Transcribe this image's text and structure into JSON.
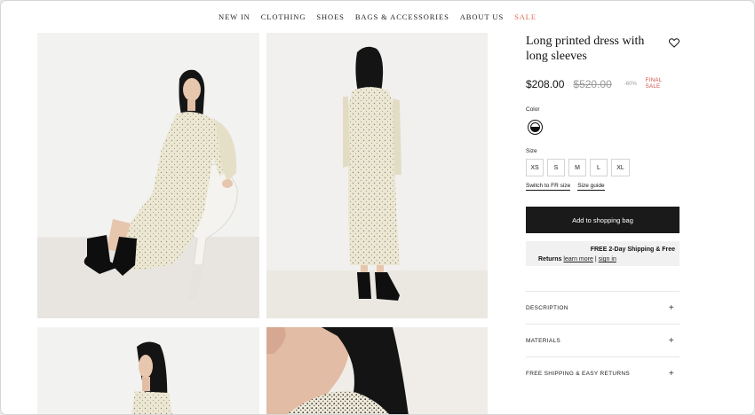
{
  "nav": {
    "items": [
      "NEW IN",
      "CLOTHING",
      "SHOES",
      "BAGS & ACCESSORIES",
      "ABOUT US",
      "SALE"
    ],
    "sale_color": "#e06b52"
  },
  "product": {
    "title": "Long printed dress with long sleeves",
    "price": "$208.00",
    "original_price": "$520.00",
    "discount": "-60%",
    "final_sale_line1": "FINAL",
    "final_sale_line2": "SALE",
    "wishlist_icon": "heart-icon"
  },
  "color": {
    "label": "Color"
  },
  "size": {
    "label": "Size",
    "options": [
      "XS",
      "S",
      "M",
      "L",
      "XL"
    ],
    "switch_label": "Switch to FR size",
    "guide_label": "Size guide"
  },
  "cta": {
    "add_to_bag": "Add to shopping bag"
  },
  "shipping": {
    "line1": "FREE 2-Day Shipping & Free",
    "line2_bold": "Returns",
    "learn_more": "learn more",
    "separator": "|",
    "sign_in": "sign in"
  },
  "accordion": [
    {
      "label": "DESCRIPTION",
      "icon": "+"
    },
    {
      "label": "MATERIALS",
      "icon": "+"
    },
    {
      "label": "FREE SHIPPING & EASY RETURNS",
      "icon": "+"
    }
  ]
}
